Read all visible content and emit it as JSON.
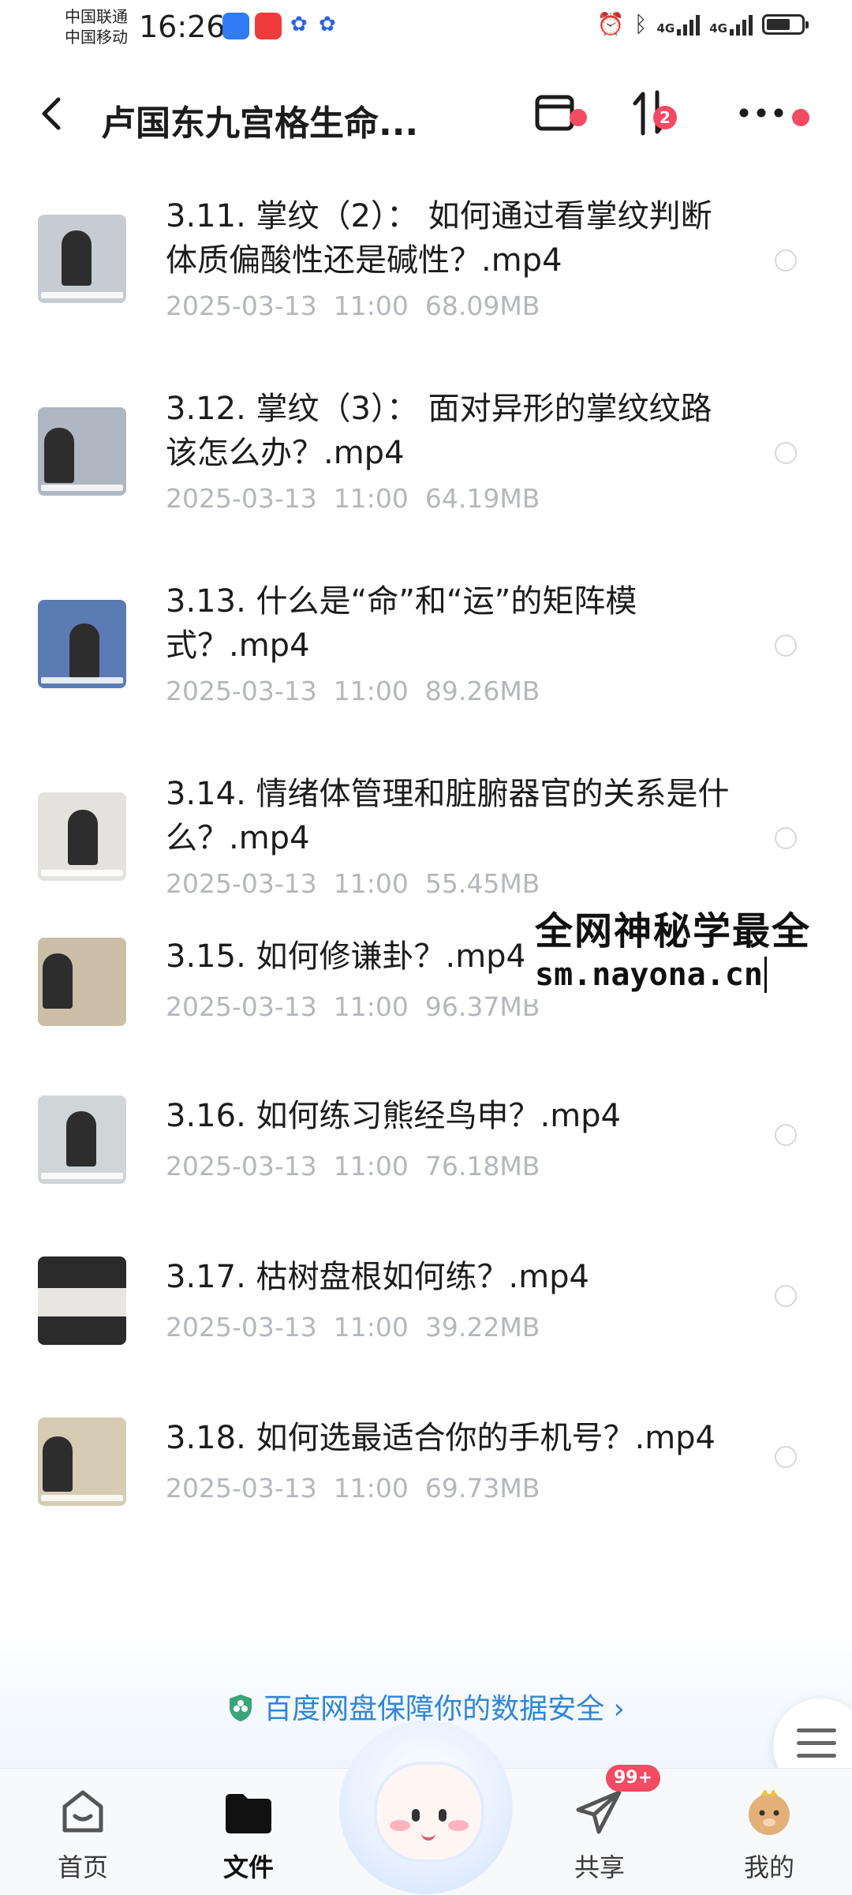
{
  "status_bar": {
    "carrier1": "中国联通",
    "carrier2": "中国移动",
    "time": "16:26",
    "network1": "4G",
    "network2": "4G",
    "icons": [
      "app-icon-blue",
      "app-icon-red",
      "baidu-paw-icon",
      "baidu-paw-icon",
      "alarm-icon",
      "bluetooth-icon",
      "signal-icon",
      "signal-icon",
      "battery-icon"
    ]
  },
  "header": {
    "title": "卢国东九宫格生命...",
    "sort_badge": "2",
    "icons": [
      "back-icon",
      "archive-icon",
      "sort-icon",
      "more-icon"
    ]
  },
  "files": [
    {
      "name": "3.11. 掌纹（2）： 如何通过看掌纹判断体质偏酸性还是碱性？.mp4",
      "date": "2025-03-13",
      "time": "11:00",
      "size": "68.09MB"
    },
    {
      "name": "3.12. 掌纹（3）： 面对异形的掌纹纹路该怎么办？.mp4",
      "date": "2025-03-13",
      "time": "11:00",
      "size": "64.19MB"
    },
    {
      "name": "3.13. 什么是“命”和“运”的矩阵模式？.mp4",
      "date": "2025-03-13",
      "time": "11:00",
      "size": "89.26MB"
    },
    {
      "name": "3.14. 情绪体管理和脏腑器官的关系是什么？.mp4",
      "date": "2025-03-13",
      "time": "11:00",
      "size": "55.45MB"
    },
    {
      "name": "3.15. 如何修谦卦？.mp4",
      "date": "2025-03-13",
      "time": "11:00",
      "size": "96.37MB"
    },
    {
      "name": "3.16. 如何练习熊经鸟申？.mp4",
      "date": "2025-03-13",
      "time": "11:00",
      "size": "76.18MB"
    },
    {
      "name": "3.17. 枯树盘根如何练？.mp4",
      "date": "2025-03-13",
      "time": "11:00",
      "size": "39.22MB"
    },
    {
      "name": "3.18. 如何选最适合你的手机号？.mp4",
      "date": "2025-03-13",
      "time": "11:00",
      "size": "69.73MB"
    }
  ],
  "watermark": {
    "line1": "全网神秘学最全",
    "line2": "sm.nayona.cn"
  },
  "security_banner": {
    "text": "百度网盘保障你的数据安全",
    "chevron": "›"
  },
  "tabbar": {
    "tabs": [
      {
        "label": "首页",
        "icon": "home-icon"
      },
      {
        "label": "文件",
        "icon": "folder-icon",
        "active": true
      },
      {
        "label": "共享",
        "icon": "paper-plane-icon",
        "badge": "99+"
      },
      {
        "label": "我的",
        "icon": "avatar-icon"
      }
    ]
  },
  "colors": {
    "accent_red": "#f44a62",
    "meta_gray": "#b4b7bd",
    "security_blue": "#2f86d6"
  }
}
